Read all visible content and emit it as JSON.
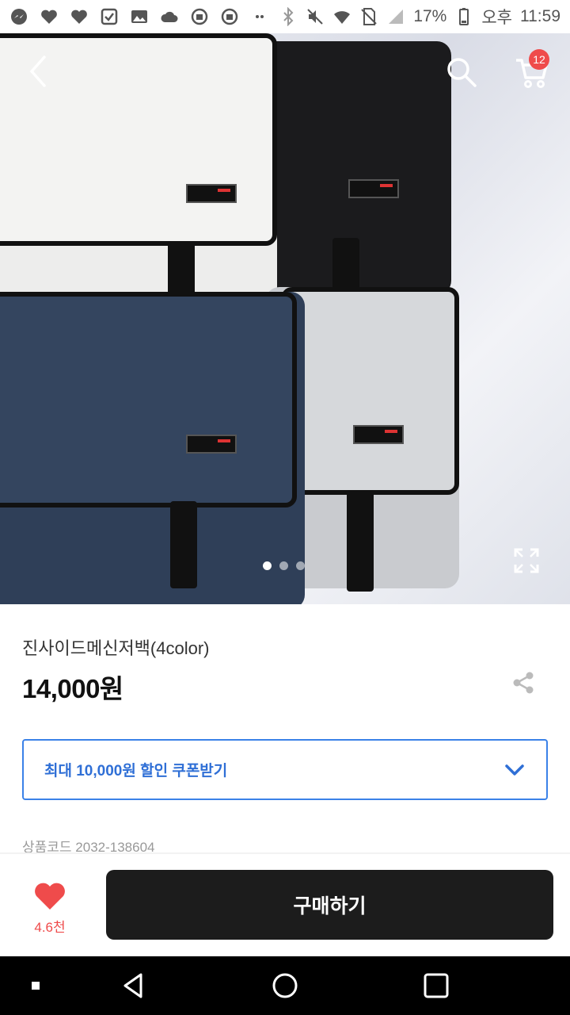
{
  "status_bar": {
    "battery": "17%",
    "ampm": "오후",
    "time": "11:59",
    "icons": [
      "messenger-icon",
      "heart-icon",
      "heart-icon",
      "app-icon",
      "gallery-icon",
      "cloud-icon",
      "android-icon",
      "android-icon",
      "more-icon",
      "bluetooth-icon",
      "mute-icon",
      "wifi-icon",
      "no-sim-icon",
      "signal-icon",
      "battery-icon"
    ]
  },
  "header": {
    "cart_count": "12",
    "icons": [
      "back-icon",
      "search-icon",
      "cart-icon"
    ]
  },
  "gallery": {
    "total_images": 3,
    "current_index": 1,
    "expand_icon": "expand-icon"
  },
  "product": {
    "name": "진사이드메신저백(4color)",
    "price": "14,000원",
    "share_icon": "share-icon"
  },
  "coupon": {
    "label": "최대 10,000원 할인 쿠폰받기",
    "accent": "#3b82e8"
  },
  "product_code": "상품코드 2032-138604",
  "bottom_bar": {
    "like_count": "4.6천",
    "buy_label": "구매하기",
    "like_color": "#ef4b4b"
  },
  "navbar": {
    "icons": [
      "recent-dot-icon",
      "back-triangle-icon",
      "home-circle-icon",
      "overview-square-icon"
    ]
  }
}
